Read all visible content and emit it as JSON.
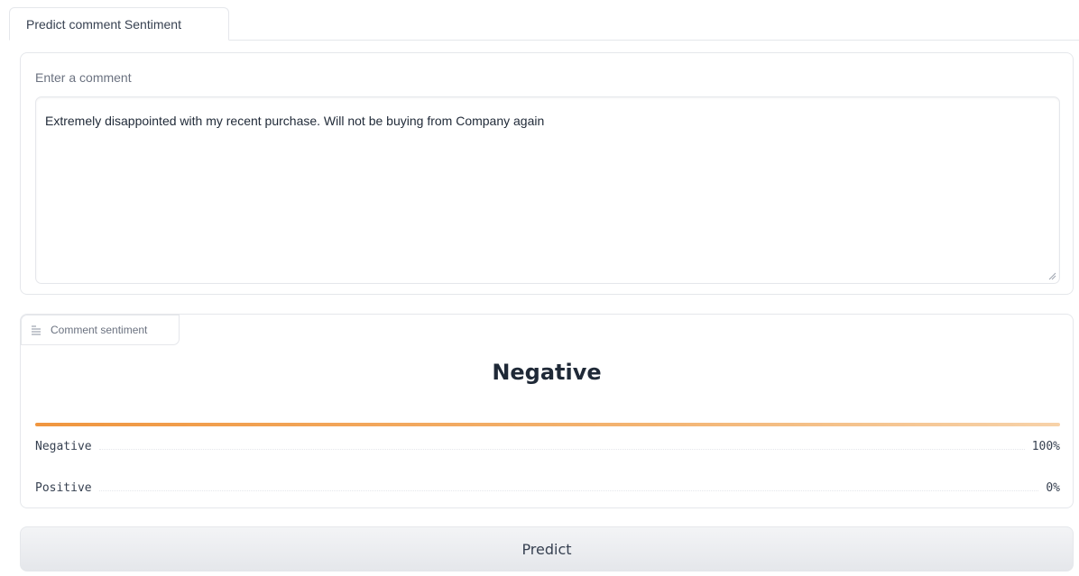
{
  "tabs": [
    {
      "label": "Predict comment Sentiment",
      "active": true
    }
  ],
  "input": {
    "label": "Enter a comment",
    "value": "Extremely disappointed with my recent purchase. Will not be buying from Company again"
  },
  "output": {
    "badge_label": "Comment sentiment",
    "badge_icon": "text-lines-icon",
    "result": "Negative",
    "confidences": [
      {
        "label": "Negative",
        "value": "100%",
        "fraction": 1.0
      },
      {
        "label": "Positive",
        "value": "0%",
        "fraction": 0.0
      }
    ],
    "accent_color": "#f0963f"
  },
  "actions": {
    "predict_label": "Predict"
  }
}
